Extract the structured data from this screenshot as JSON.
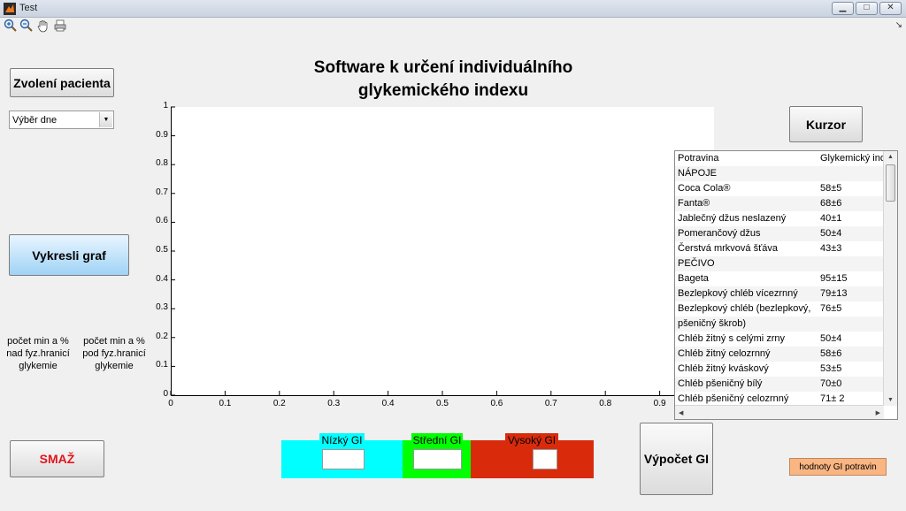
{
  "window": {
    "title": "Test",
    "minimize_label": "▭",
    "maximize_label": "□",
    "close_label": "✕"
  },
  "toolbar": {
    "tools": [
      "zoom-in-icon",
      "zoom-out-icon",
      "pan-hand-icon",
      "print-icon"
    ]
  },
  "buttons": {
    "select_patient": "Zvolení pacienta",
    "draw_graph": "Vykresli graf",
    "delete": "SMAŽ",
    "cursor": "Kurzor",
    "compute_gi": "Výpočet GI",
    "gi_values": "hodnoty GI potravin"
  },
  "day_select": {
    "value": "Výběr dne"
  },
  "title_line1": "Software k určení individuálního",
  "title_line2": "glykemického indexu",
  "stats": {
    "above": [
      "počet min a %",
      "nad fyz.hranicí",
      "glykemie"
    ],
    "below": [
      "počet min a %",
      "pod fyz.hranicí",
      "glykemie"
    ]
  },
  "axes": {
    "y_ticks": [
      "1",
      "0.9",
      "0.8",
      "0.7",
      "0.6",
      "0.5",
      "0.4",
      "0.3",
      "0.2",
      "0.1",
      "0"
    ],
    "x_ticks": [
      "0",
      "0.1",
      "0.2",
      "0.3",
      "0.4",
      "0.5",
      "0.6",
      "0.7",
      "0.8",
      "0.9"
    ]
  },
  "table": {
    "headers": [
      "Potravina",
      "Glykemický ind"
    ],
    "rows": [
      [
        "NÁPOJE",
        ""
      ],
      [
        "Coca Cola®",
        "58±5"
      ],
      [
        "Fanta®",
        "68±6"
      ],
      [
        "Jablečný džus neslazený",
        "40±1"
      ],
      [
        "Pomerančový džus",
        "50±4"
      ],
      [
        "Čerstvá mrkvová šťáva",
        "43±3"
      ],
      [
        "PEČIVO",
        ""
      ],
      [
        "Bageta",
        "95±15"
      ],
      [
        "Bezlepkový chléb vícezrnný",
        "79±13"
      ],
      [
        "Bezlepkový chléb (bezlepkový,",
        "76±5"
      ],
      [
        "pšeničný škrob)",
        ""
      ],
      [
        "Chléb žitný s celými zrny",
        "50±4"
      ],
      [
        "Chléb žitný celozrnný",
        "58±6"
      ],
      [
        "Chléb žitný kváskový",
        "53±5"
      ],
      [
        "Chléb pšeničný bílý",
        "70±0"
      ],
      [
        "Chléb pšeničný celozrnný",
        "71± 2"
      ]
    ]
  },
  "gi": {
    "low": {
      "label": "Nízký GI",
      "color": "#00ffff"
    },
    "mid": {
      "label": "Střední GI",
      "color": "#00ff00"
    },
    "high": {
      "label": "Vysoký GI",
      "color": "#d92b0b"
    }
  },
  "colors": {
    "delete_text": "#e0151e",
    "draw_btn_top": "#e9f5ff",
    "draw_btn_bottom": "#9fd3f5"
  }
}
